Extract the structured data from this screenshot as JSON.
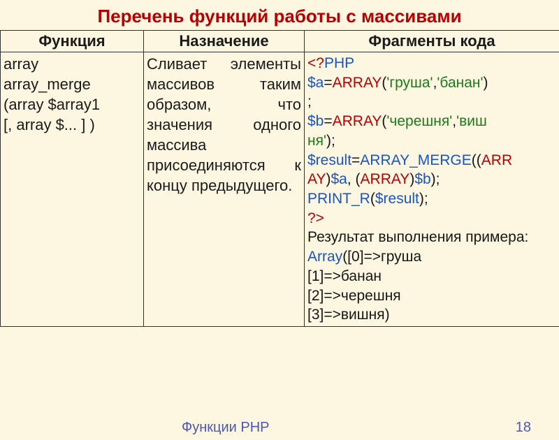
{
  "title": "Перечень функций работы с массивами",
  "headers": {
    "c1": "Функция",
    "c2": "Назначение",
    "c3": "Фрагменты кода"
  },
  "row": {
    "func": {
      "l1": "array",
      "l2": "array_merge",
      "l3": "(array  $array1",
      "l4": "[, array $... ] )"
    },
    "desc": "Сливает элементы массивов таким образом, что значения одного массива присоединяютс­я к концу предыдущего.",
    "code": {
      "open_tag": "<?",
      "php": "PHP",
      "a_var": "$a",
      "eq": "=",
      "array_kw": "array",
      "lp": "(",
      "rp": ")",
      "comma": ",",
      "semi": ";",
      "s_grusha": "'груша'",
      "s_banan": "'банан'",
      "b_var": "$b",
      "s_chereshnya": "'черешня'",
      "s_vishnya_p1": "'виш",
      "s_vishnya_p2": "ня'",
      "result_var": "$result",
      "merge_p1": "array_merge",
      "merge_p2_open": "((",
      "merge_arr1": "arr",
      "merge_arr2": "ay",
      "cast_lp": "(",
      "cast_rp": ")",
      "printr": "print_r",
      "close_tag": "?>",
      "result_label": "Результат выполнения примера:",
      "out_arr": "Array",
      "out0": "([0]=>груша",
      "out1": "[1]=>банан",
      "out2": "[2]=>черешня",
      "out3": "[3]=>вишня)"
    }
  },
  "footer": {
    "label": "Функции PHP",
    "page": "18"
  }
}
